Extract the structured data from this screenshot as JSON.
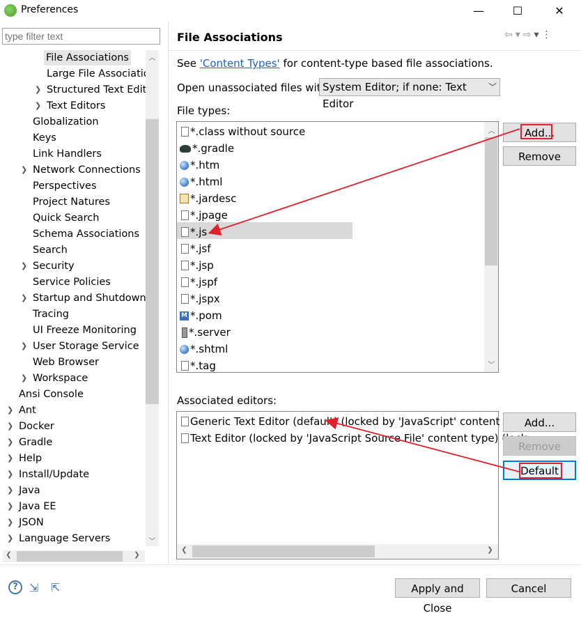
{
  "window": {
    "title": "Preferences",
    "minimize": "—",
    "maximize": "☐",
    "close": "✕"
  },
  "sidebar": {
    "filter_placeholder": "type filter text",
    "items": [
      {
        "label": "File Associations",
        "selected": true
      },
      {
        "label": "Large File Association"
      },
      {
        "label": "Structured Text Edito",
        "expandable": true
      },
      {
        "label": "Text Editors",
        "expandable": true
      },
      {
        "label": "Globalization"
      },
      {
        "label": "Keys"
      },
      {
        "label": "Link Handlers"
      },
      {
        "label": "Network Connections",
        "expandable": true
      },
      {
        "label": "Perspectives"
      },
      {
        "label": "Project Natures"
      },
      {
        "label": "Quick Search"
      },
      {
        "label": "Schema Associations"
      },
      {
        "label": "Search"
      },
      {
        "label": "Security",
        "expandable": true
      },
      {
        "label": "Service Policies"
      },
      {
        "label": "Startup and Shutdown",
        "expandable": true
      },
      {
        "label": "Tracing"
      },
      {
        "label": "UI Freeze Monitoring"
      },
      {
        "label": "User Storage Service",
        "expandable": true
      },
      {
        "label": "Web Browser"
      },
      {
        "label": "Workspace",
        "expandable": true
      },
      {
        "label": "Ansi Console"
      },
      {
        "label": "Ant",
        "expandable": true
      },
      {
        "label": "Docker",
        "expandable": true
      },
      {
        "label": "Gradle",
        "expandable": true
      },
      {
        "label": "Help",
        "expandable": true
      },
      {
        "label": "Install/Update",
        "expandable": true
      },
      {
        "label": "Java",
        "expandable": true
      },
      {
        "label": "Java EE",
        "expandable": true
      },
      {
        "label": "JSON",
        "expandable": true
      },
      {
        "label": "Language Servers",
        "expandable": true
      }
    ]
  },
  "page": {
    "title": "File Associations",
    "see_prefix": "See",
    "content_types_link": "'Content Types'",
    "see_suffix": "for content-type based file associations.",
    "open_unassociated_label": "Open unassociated files with:",
    "open_unassociated_value": "System Editor; if none: Text Editor",
    "file_types_label": "File types:",
    "file_types": [
      {
        "name": "*.class without source",
        "icon": "class-file-icon"
      },
      {
        "name": "*.gradle",
        "icon": "gradle-icon"
      },
      {
        "name": "*.htm",
        "icon": "globe-icon"
      },
      {
        "name": "*.html",
        "icon": "globe-icon"
      },
      {
        "name": "*.jardesc",
        "icon": "jar-icon"
      },
      {
        "name": "*.jpage",
        "icon": "java-page-icon"
      },
      {
        "name": "*.js",
        "icon": "text-file-icon",
        "selected": true
      },
      {
        "name": "*.jsf",
        "icon": "text-file-icon"
      },
      {
        "name": "*.jsp",
        "icon": "text-file-icon"
      },
      {
        "name": "*.jspf",
        "icon": "text-file-icon"
      },
      {
        "name": "*.jspx",
        "icon": "text-file-icon"
      },
      {
        "name": "*.pom",
        "icon": "maven-icon"
      },
      {
        "name": "*.server",
        "icon": "server-icon"
      },
      {
        "name": "*.shtml",
        "icon": "globe-icon"
      },
      {
        "name": "*.tag",
        "icon": "text-file-icon"
      }
    ],
    "file_types_add": "Add...",
    "file_types_remove": "Remove",
    "associated_editors_label": "Associated editors:",
    "editors": [
      {
        "name": "Generic Text Editor (default) (locked by 'JavaScript' content type",
        "icon": "generic-editor-icon"
      },
      {
        "name": "Text Editor (locked by 'JavaScript Source File' content type) (lock",
        "icon": "text-file-icon"
      }
    ],
    "editors_add": "Add...",
    "editors_remove": "Remove",
    "editors_default": "Default"
  },
  "footer": {
    "apply_close": "Apply and Close",
    "cancel": "Cancel"
  },
  "colors": {
    "annotation_red": "#e0202a",
    "link_blue": "#1f5fbf",
    "focus_blue": "#0078d7"
  }
}
